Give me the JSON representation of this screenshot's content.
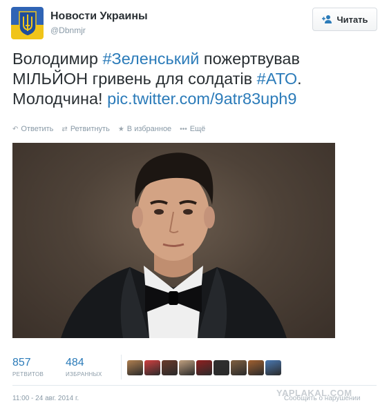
{
  "account": {
    "name": "Новости Украины",
    "handle": "@Dbnmjr",
    "avatar_icon": "trident-coat-of-arms-icon",
    "follow_label": "Читать",
    "follow_icon": "follow-user-icon"
  },
  "tweet": {
    "segments": [
      {
        "text": "Володимир ",
        "type": "text"
      },
      {
        "text": "#Зеленський",
        "type": "hashtag"
      },
      {
        "text": " пожертвував МІЛЬЙОН гривень для солдатів ",
        "type": "text"
      },
      {
        "text": "#АТО",
        "type": "hashtag"
      },
      {
        "text": ". Молодчина! ",
        "type": "text"
      },
      {
        "text": "pic.twitter.com/9atr83uph9",
        "type": "link"
      }
    ],
    "link_color": "#2b7bb9"
  },
  "actions": [
    {
      "label": "Ответить",
      "icon": "reply-icon",
      "glyph": "↶"
    },
    {
      "label": "Ретвитнуть",
      "icon": "retweet-icon",
      "glyph": "⇄"
    },
    {
      "label": "В избранное",
      "icon": "star-icon",
      "glyph": "★"
    },
    {
      "label": "Ещё",
      "icon": "more-icon",
      "glyph": "•••"
    }
  ],
  "stats": {
    "retweets": {
      "value": "857",
      "label": "РЕТВИТОВ"
    },
    "favorites": {
      "value": "484",
      "label": "ИЗБРАННЫХ"
    }
  },
  "favoriter_avatars": [
    "#b08050",
    "#d04040",
    "#6a3a2a",
    "#c0a080",
    "#902020",
    "#303030",
    "#806040",
    "#a06030",
    "#4a78b0"
  ],
  "footer": {
    "timestamp": "11:00 - 24 авг. 2014 г.",
    "report": "Сообщить о нарушении",
    "watermark": "YAPLAKAL.COM"
  }
}
